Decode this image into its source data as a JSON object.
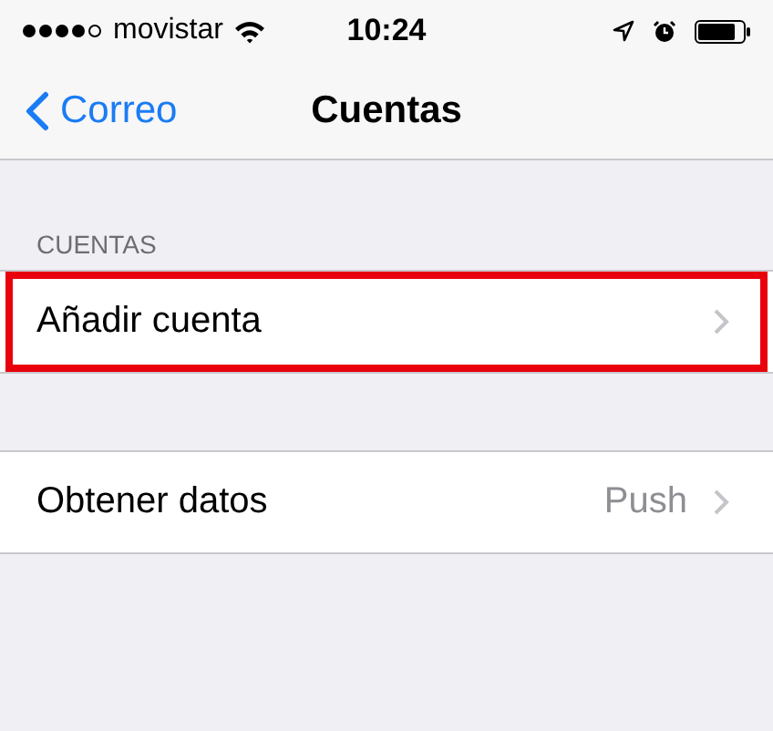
{
  "status_bar": {
    "carrier": "movistar",
    "time": "10:24"
  },
  "nav_bar": {
    "back": "Correo",
    "title": "Cuentas"
  },
  "sections": [
    {
      "header": "CUENTAS",
      "rows": [
        {
          "label": "Añadir cuenta",
          "highlighted": true
        }
      ]
    },
    {
      "rows": [
        {
          "label": "Obtener datos",
          "detail": "Push",
          "highlighted": false
        }
      ]
    }
  ]
}
